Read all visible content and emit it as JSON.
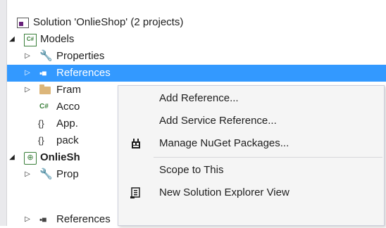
{
  "tree": {
    "solution_label": "Solution 'OnlieShop' (2 projects)",
    "models_label": "Models",
    "properties_label": "Properties",
    "references_label": "References",
    "framework_label": "Fram",
    "account_label": "Acco",
    "app_config_label": "App.",
    "packages_config_label": "pack",
    "onlieshop_label": "OnlieSh",
    "onlieshop_properties_label": "Prop",
    "onlieshop_references_label": "References"
  },
  "context_menu": {
    "items": [
      {
        "label": "Add Reference..."
      },
      {
        "label": "Add Service Reference..."
      },
      {
        "label": "Manage NuGet Packages...",
        "icon": "nuget-icon"
      },
      {
        "label": "Scope to This"
      },
      {
        "label": "New Solution Explorer View",
        "icon": "new-explorer-view-icon"
      }
    ]
  },
  "colors": {
    "selection": "#3399ff",
    "menu_background": "#f5f5f5",
    "menu_border": "#cccedb"
  }
}
